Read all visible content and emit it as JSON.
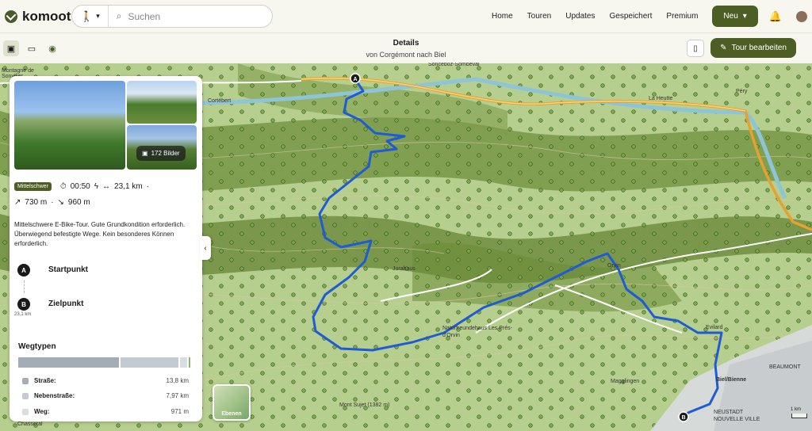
{
  "header": {
    "logo_text": "komoot",
    "search_placeholder": "Suchen",
    "nav": [
      "Home",
      "Touren",
      "Updates",
      "Gespeichert",
      "Premium"
    ],
    "new_button": "Neu"
  },
  "subbar": {
    "title": "Details",
    "subtitle": "von Corgémont nach Biel",
    "edit_button": "Tour bearbeiten"
  },
  "tour": {
    "photo_count": "172 Bilder",
    "difficulty": "Mittelschwer",
    "duration": "00:50",
    "distance": "23,1 km",
    "ascent": "730 m",
    "descent": "960 m",
    "description": "Mittelschwere E-Bike-Tour. Gute Grundkondition erforderlich. Überwiegend befestigte Wege. Kein besonderes Können erforderlich.",
    "waypoints": [
      {
        "marker": "A",
        "label": "Startpunkt",
        "sub": ""
      },
      {
        "marker": "B",
        "label": "Zielpunkt",
        "sub": "23,1 km"
      }
    ]
  },
  "wegtypen": {
    "title": "Wegtypen",
    "items": [
      {
        "name": "Straße:",
        "value": "13,8 km",
        "color": "#a4acb6",
        "fraction": 0.597
      },
      {
        "name": "Nebenstraße:",
        "value": "7,97 km",
        "color": "#c3cad1",
        "fraction": 0.345
      },
      {
        "name": "Weg:",
        "value": "971 m",
        "color": "#d9dde1",
        "fraction": 0.042
      }
    ]
  },
  "map": {
    "layers_label": "Ebenen",
    "scale_label": "1 km",
    "labels": [
      "Sonceboz-Sombeval",
      "Cortébert",
      "La Heutte",
      "Péry",
      "Jurahaus",
      "Orvin",
      "Naturfreundehaus Les Prés-d'Orvin",
      "Evilard",
      "Magglingen",
      "Biel/Bienne",
      "Mont Sujet (1382 m)",
      "Chasseral",
      "Montagne de Sonvilier",
      "BEAUMONT",
      "NEUSTADT NOUVELLE VILLE"
    ]
  },
  "colors": {
    "brand": "#4c5e24",
    "route": "#1e5bd6"
  }
}
